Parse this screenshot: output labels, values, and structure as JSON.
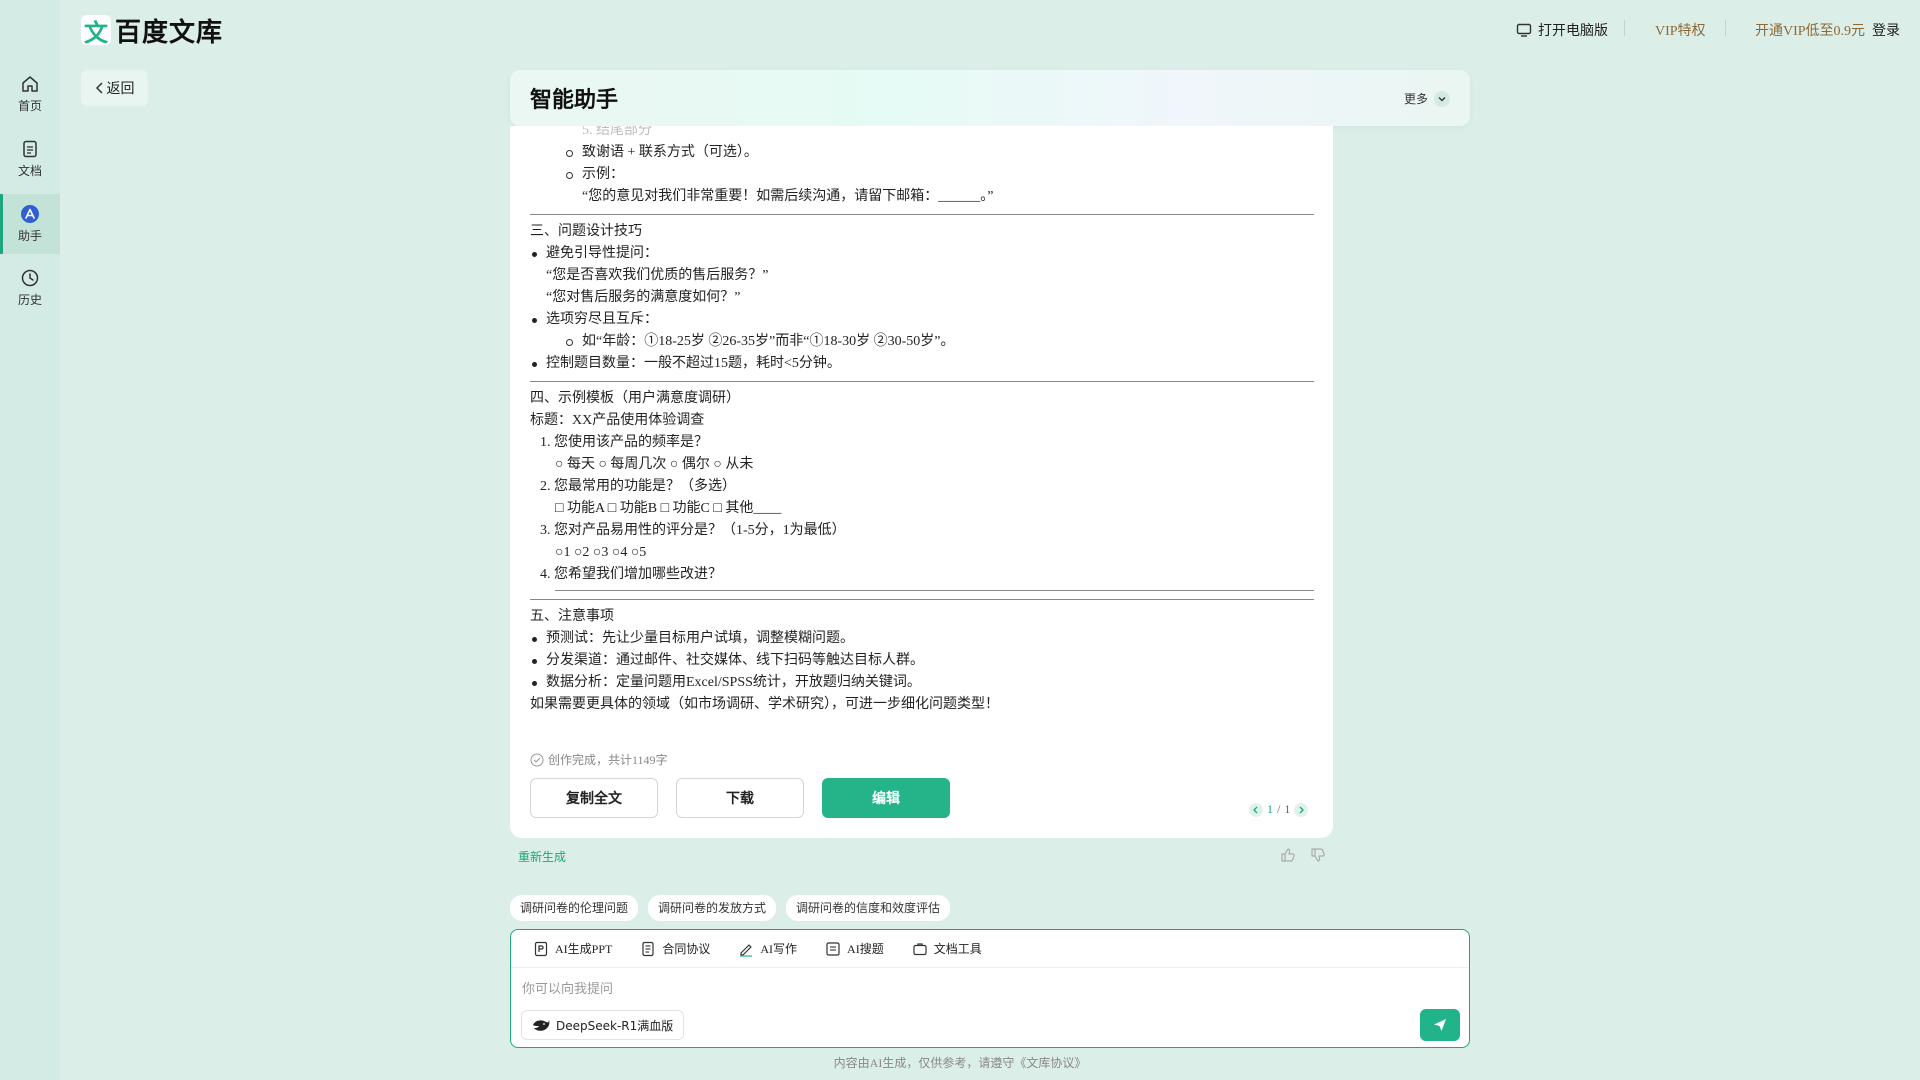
{
  "brand": {
    "mark": "文",
    "name": "百度文库"
  },
  "back_label": "返回",
  "topbar": {
    "pc": "打开电脑版",
    "vip": "VIP特权",
    "open_vip": "开通VIP低至0.9元",
    "login": "登录"
  },
  "sidebar": {
    "items": [
      {
        "label": "首页",
        "icon": "home-icon"
      },
      {
        "label": "文档",
        "icon": "document-icon"
      },
      {
        "label": "助手",
        "icon": "assistant-icon",
        "active": true
      },
      {
        "label": "历史",
        "icon": "history-icon"
      }
    ]
  },
  "header": {
    "title": "智能助手",
    "more": "更多"
  },
  "content": {
    "faded_top": "5. 结尾部分",
    "s2_b1": "致谢语 + 联系方式（可选）。",
    "s2_b2": "示例：",
    "s2_example": "“您的意见对我们非常重要！如需后续沟通，请留下邮箱：______。”",
    "s3_title": "三、问题设计技巧",
    "s3_b1": "避免引导性提问：",
    "s3_b1_l1": "“您是否喜欢我们优质的售后服务？”",
    "s3_b1_l2": "“您对售后服务的满意度如何？”",
    "s3_b2": "选项穷尽且互斥：",
    "s3_b2_sub": "如“年龄：①18-25岁 ②26-35岁”而非“①18-30岁 ②30-50岁”。",
    "s3_b3": "控制题目数量：一般不超过15题，耗时<5分钟。",
    "s4_title": "四、示例模板（用户满意度调研）",
    "s4_heading": "标题：XX产品使用体验调查",
    "s4_q1": "1. 您使用该产品的频率是？",
    "s4_q1_opts": "○ 每天 ○ 每周几次 ○ 偶尔 ○ 从未",
    "s4_q2": "2. 您最常用的功能是？（多选）",
    "s4_q2_opts": "□ 功能A □ 功能B □ 功能C □ 其他____",
    "s4_q3": "3. 您对产品易用性的评分是？（1-5分，1为最低）",
    "s4_q3_opts": "○1 ○2 ○3 ○4 ○5",
    "s4_q4": "4. 您希望我们增加哪些改进？",
    "s5_title": "五、注意事项",
    "s5_b1": "预测试：先让少量目标用户试填，调整模糊问题。",
    "s5_b2": "分发渠道：通过邮件、社交媒体、线下扫码等触达目标人群。",
    "s5_b3": "数据分析：定量问题用Excel/SPSS统计，开放题归纳关键词。",
    "closing": "如果需要更具体的领域（如市场调研、学术研究），可进一步细化问题类型！"
  },
  "status": "创作完成，共计1149字",
  "actions": {
    "copy": "复制全文",
    "download": "下载",
    "edit": "编辑"
  },
  "pager": {
    "current": "1",
    "sep": "/",
    "total": "1"
  },
  "regenerate": "重新生成",
  "suggestions": [
    "调研问卷的伦理问题",
    "调研问卷的发放方式",
    "调研问卷的信度和效度评估"
  ],
  "tools": [
    {
      "label": "AI生成PPT",
      "icon": "ppt-icon"
    },
    {
      "label": "合同协议",
      "icon": "contract-icon"
    },
    {
      "label": "AI写作",
      "icon": "pen-icon"
    },
    {
      "label": "AI搜题",
      "icon": "search-question-icon"
    },
    {
      "label": "文档工具",
      "icon": "briefcase-icon"
    }
  ],
  "input": {
    "placeholder": "你可以向我提问"
  },
  "model": "DeepSeek-R1满血版",
  "footer": "内容由AI生成，仅供参考，请遵守《文库协议》",
  "colors": {
    "accent": "#21b48a",
    "background": "#dceee8"
  }
}
